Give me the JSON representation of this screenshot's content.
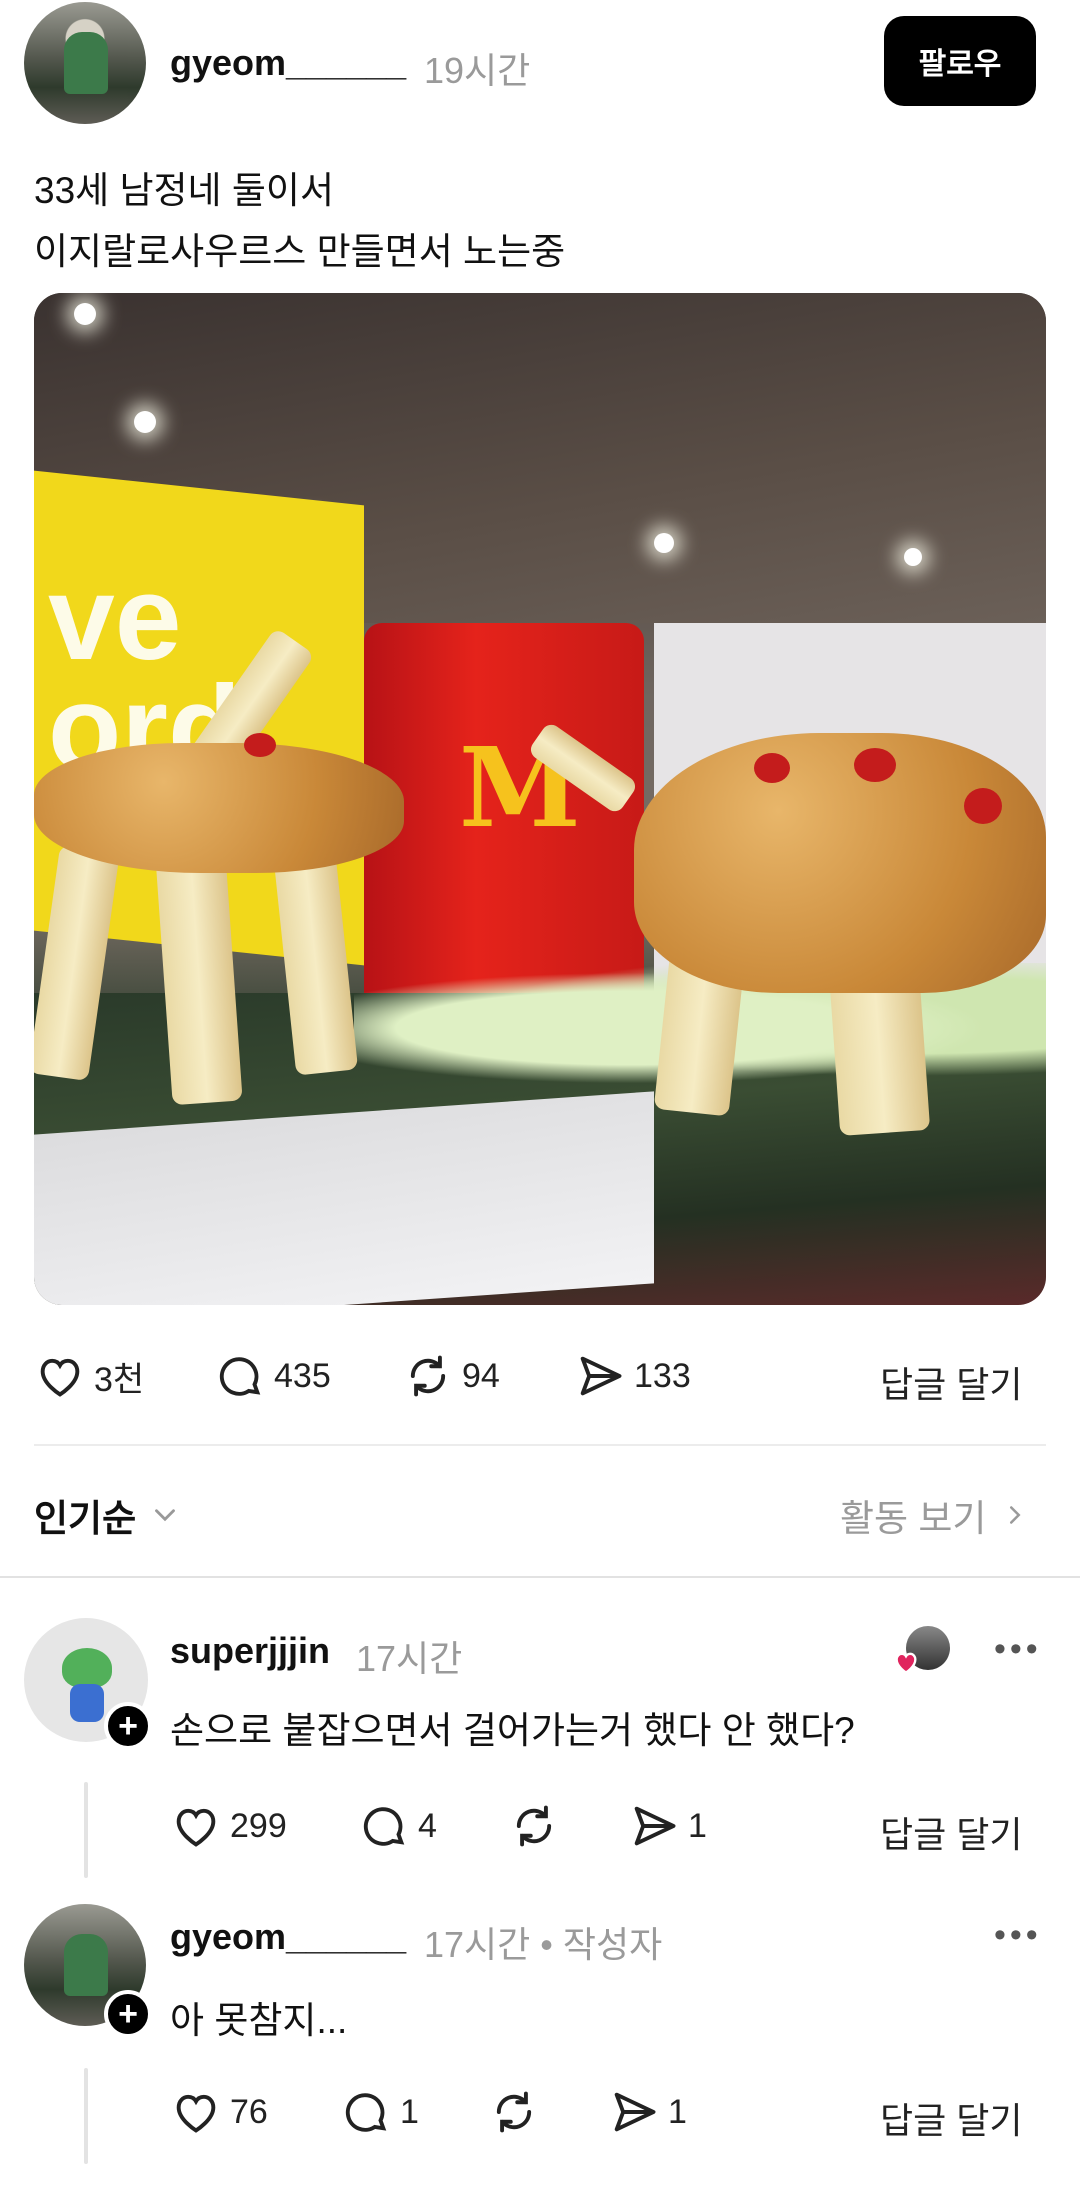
{
  "post": {
    "username": "gyeom______",
    "time": "19시간",
    "follow_label": "팔로우",
    "text_line1": "33세 남정네 둘이서",
    "text_line2": "이지랄로사우르스 만들면서 노는중",
    "photo_wall_text": "ve\nord",
    "stats": {
      "likes": "3천",
      "comments": "435",
      "reposts": "94",
      "shares": "133"
    },
    "reply_label": "답글 달기"
  },
  "sort": {
    "label": "인기순",
    "activity_label": "활동 보기"
  },
  "comments": [
    {
      "username": "superjjjin",
      "time": "17시간",
      "text": "손으로 붙잡으면서 걸어가는거 했다 안 했다?",
      "likes": "299",
      "replies": "4",
      "shares": "1",
      "reply_label": "답글 달기"
    },
    {
      "username": "gyeom______",
      "time": "17시간 • 작성자",
      "text": "아 못참지...",
      "likes": "76",
      "replies": "1",
      "shares": "1",
      "reply_label": "답글 달기"
    }
  ],
  "icons": {
    "like": "heart-icon",
    "comment": "comment-bubble-icon",
    "repost": "repost-icon",
    "share": "send-icon",
    "more": "more-icon",
    "chevron": "chevron-down-icon"
  },
  "colors": {
    "follow_button_bg": "#000000",
    "secondary_text": "#9a9a9a",
    "heart_badge": "#e0245e"
  },
  "more_glyph": "•••"
}
